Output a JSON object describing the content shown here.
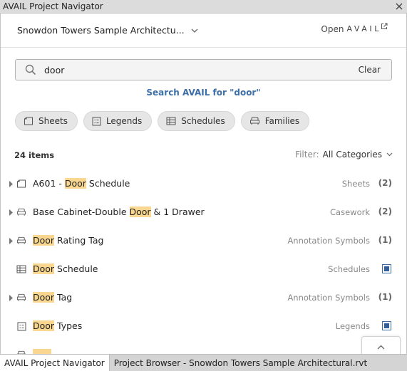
{
  "window": {
    "title": "AVAIL Project Navigator"
  },
  "header": {
    "project": "Snowdon Towers Sample Architectu...",
    "open_prefix": "Open",
    "open_brand": "AVAIL"
  },
  "search": {
    "value": "door",
    "placeholder": "",
    "clear_label": "Clear",
    "avail_link": "Search AVAIL for \"door\""
  },
  "chips": [
    {
      "label": "Sheets",
      "icon": "sheet-icon"
    },
    {
      "label": "Legends",
      "icon": "legend-icon"
    },
    {
      "label": "Schedules",
      "icon": "schedule-icon"
    },
    {
      "label": "Families",
      "icon": "family-icon"
    }
  ],
  "results": {
    "count_label": "24 items",
    "filter_label": "Filter:",
    "filter_value": "All Categories"
  },
  "items": [
    {
      "pre": "A601 - ",
      "hl": "Door",
      "post": " Schedule",
      "category": "Sheets",
      "count": "(2)",
      "icon": "sheet-icon",
      "expandable": true
    },
    {
      "pre": "Base Cabinet-Double ",
      "hl": "Door",
      "post": " & 1 Drawer",
      "category": "Casework",
      "count": "(2)",
      "icon": "family-icon",
      "expandable": true
    },
    {
      "pre": "",
      "hl": "Door",
      "post": " Rating Tag",
      "category": "Annotation Symbols",
      "count": "(1)",
      "icon": "family-icon",
      "expandable": true
    },
    {
      "pre": "",
      "hl": "Door",
      "post": " Schedule",
      "category": "Schedules",
      "count": "",
      "icon": "schedule-icon",
      "expandable": false
    },
    {
      "pre": "",
      "hl": "Door",
      "post": " Tag",
      "category": "Annotation Symbols",
      "count": "(1)",
      "icon": "family-icon",
      "expandable": true
    },
    {
      "pre": "",
      "hl": "Door",
      "post": " Types",
      "category": "Legends",
      "count": "",
      "icon": "legend-icon",
      "expandable": false
    }
  ],
  "tabs": [
    {
      "label": "AVAIL Project Navigator",
      "active": true
    },
    {
      "label": "Project Browser - Snowdon Towers Sample Architectural.rvt",
      "active": false
    }
  ],
  "colors": {
    "accent": "#3c6ea8",
    "highlight": "#fad790"
  }
}
